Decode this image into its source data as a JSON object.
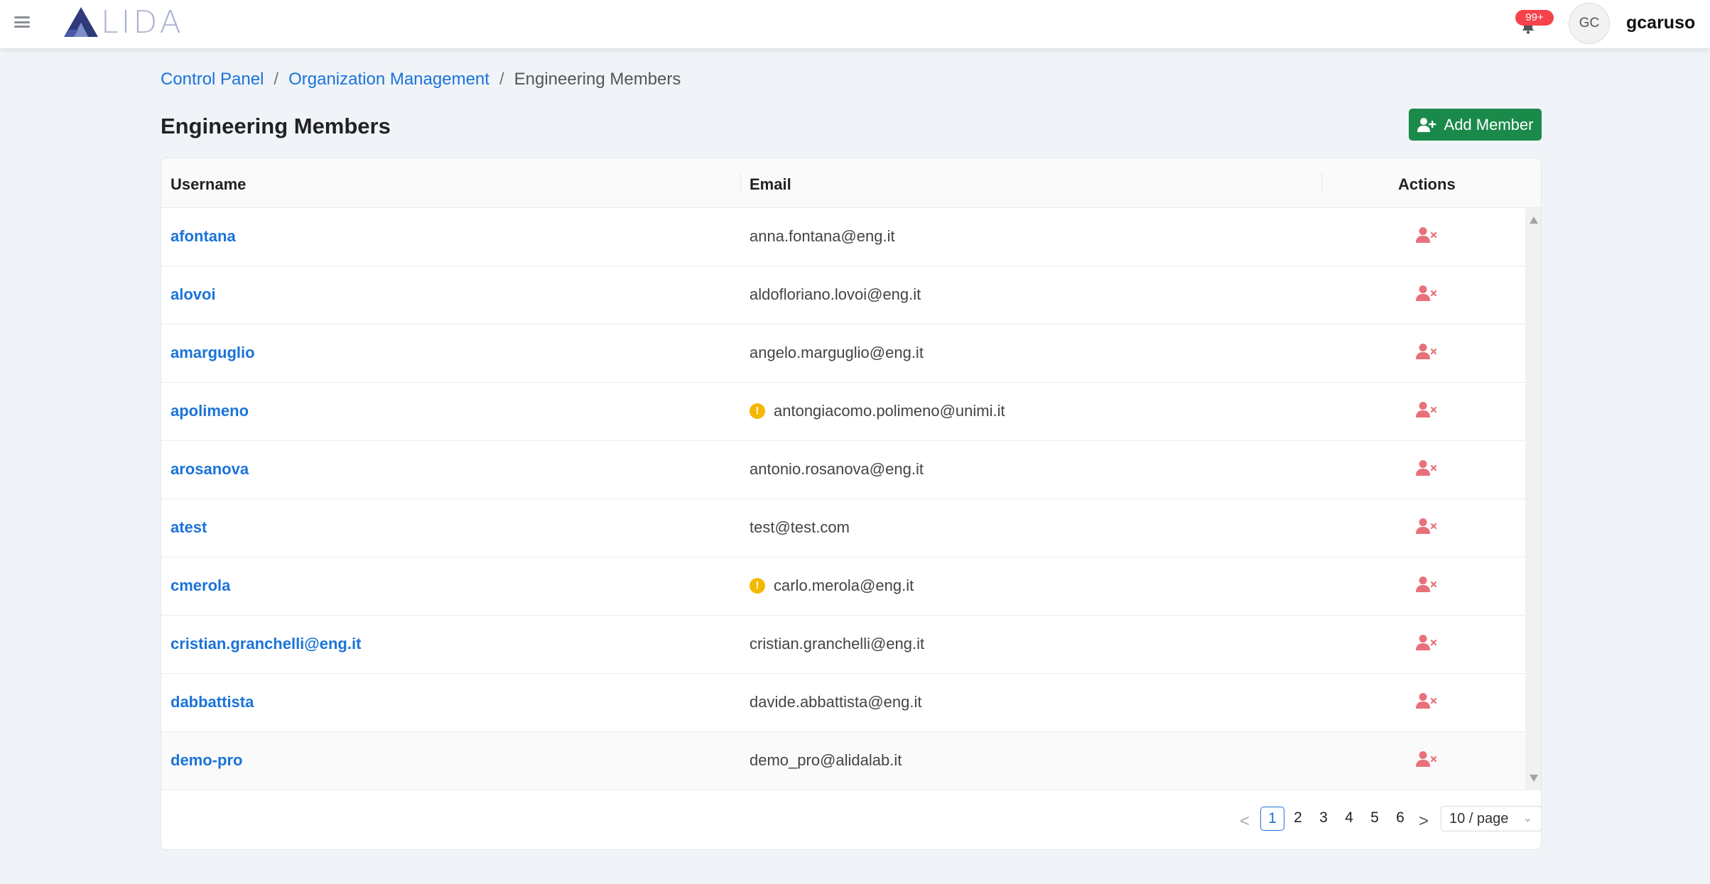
{
  "header": {
    "logo_text": "LIDA",
    "notification_badge": "99+",
    "avatar_initials": "GC",
    "username": "gcaruso"
  },
  "breadcrumb": {
    "items": [
      "Control Panel",
      "Organization Management"
    ],
    "current": "Engineering Members"
  },
  "page": {
    "title": "Engineering Members",
    "add_button_label": "Add Member"
  },
  "table": {
    "columns": [
      "Username",
      "Email",
      "Actions"
    ],
    "rows": [
      {
        "username": "afontana",
        "email": "anna.fontana@eng.it",
        "warning": false
      },
      {
        "username": "alovoi",
        "email": "aldofloriano.lovoi@eng.it",
        "warning": false
      },
      {
        "username": "amarguglio",
        "email": "angelo.marguglio@eng.it",
        "warning": false
      },
      {
        "username": "apolimeno",
        "email": "antongiacomo.polimeno@unimi.it",
        "warning": true
      },
      {
        "username": "arosanova",
        "email": "antonio.rosanova@eng.it",
        "warning": false
      },
      {
        "username": "atest",
        "email": "test@test.com",
        "warning": false
      },
      {
        "username": "cmerola",
        "email": "carlo.merola@eng.it",
        "warning": true
      },
      {
        "username": "cristian.granchelli@eng.it",
        "email": "cristian.granchelli@eng.it",
        "warning": false
      },
      {
        "username": "dabbattista",
        "email": "davide.abbattista@eng.it",
        "warning": false
      },
      {
        "username": "demo-pro",
        "email": "demo_pro@alidalab.it",
        "warning": false
      }
    ]
  },
  "pagination": {
    "prev": "<",
    "next": ">",
    "pages": [
      "1",
      "2",
      "3",
      "4",
      "5",
      "6"
    ],
    "current_page": "1",
    "page_size": "10 / page"
  },
  "colors": {
    "accent": "#1a73d9",
    "add_button": "#1a8a4a",
    "remove_icon": "#e8707a",
    "warning": "#f5b800",
    "badge": "#f5424b"
  },
  "icons": {
    "menu": "hamburger-icon",
    "bell": "bell-icon",
    "add": "user-plus-icon",
    "remove": "user-remove-icon",
    "warning": "exclamation-icon"
  }
}
